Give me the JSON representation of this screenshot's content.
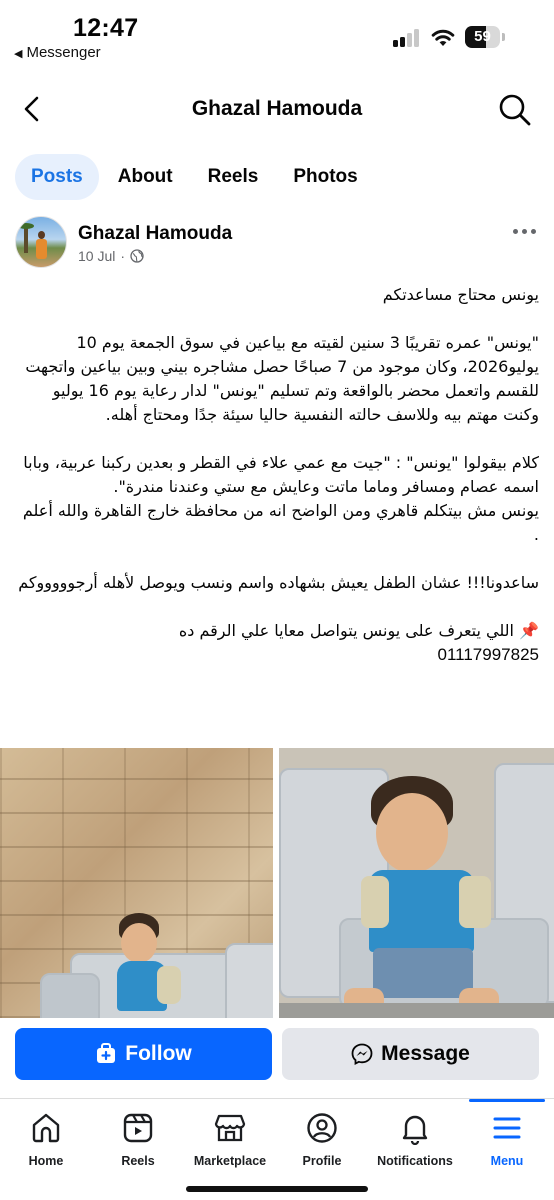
{
  "status_bar": {
    "time": "12:47",
    "back_app": "Messenger",
    "battery": "59",
    "battery_level": 0.59
  },
  "header": {
    "title": "Ghazal Hamouda",
    "back_icon": "chevron-left-icon",
    "search_icon": "search-icon"
  },
  "tabs": [
    {
      "label": "Posts",
      "active": true
    },
    {
      "label": "About",
      "active": false
    },
    {
      "label": "Reels",
      "active": false
    },
    {
      "label": "Photos",
      "active": false
    }
  ],
  "post": {
    "author": "Ghazal Hamouda",
    "date": "10 Jul",
    "dot": "·",
    "audience_icon": "globe-icon",
    "lines": [
      "يونس محتاج مساعدتكم",
      "",
      "\"يونس\" عمره تقريبًا 3 سنين لقيته مع بياعين في سوق الجمعة يوم 10 يوليو2026، وكان موجود من 7 صباحًا حصل مشاجره بيني وبين بياعين واتجهت للقسم واتعمل محضر بالواقعة وتم تسليم \"يونس\" لدار رعاية يوم 16 يوليو وكنت مهتم بيه  وللاسف حالته النفسية حاليا سيئة جدًا ومحتاج أهله.",
      "",
      "كلام بيقولوا \"يونس\" : \"جيت مع عمي علاء في القطر و بعدين ركبنا عربية، وبابا اسمه عصام ومسافر وماما ماتت وعايش مع ستي  وعندنا مندرة\".",
      " يونس مش بيتكلم قاهري ومن الواضح انه من محافظة خارج القاهرة والله أعلم .",
      "",
      " ساعدونا!!! عشان الطفل يعيش بشهاده واسم ونسب ويوصل لأهله أرجوووووكم",
      "",
      "📌 اللي يتعرف على يونس يتواصل معايا علي الرقم ده",
      "01117997825"
    ]
  },
  "actions": {
    "follow": "Follow",
    "message": "Message"
  },
  "bottom_nav": [
    {
      "label": "Home",
      "icon": "home-icon",
      "active": false
    },
    {
      "label": "Reels",
      "icon": "reels-icon",
      "active": false
    },
    {
      "label": "Marketplace",
      "icon": "marketplace-icon",
      "active": false
    },
    {
      "label": "Profile",
      "icon": "profile-icon",
      "active": false
    },
    {
      "label": "Notifications",
      "icon": "bell-icon",
      "active": false
    },
    {
      "label": "Menu",
      "icon": "menu-icon",
      "active": true
    }
  ],
  "colors": {
    "accent": "#0866ff",
    "tab_active_bg": "#e7f0fd",
    "secondary_button": "#e4e6eb"
  }
}
